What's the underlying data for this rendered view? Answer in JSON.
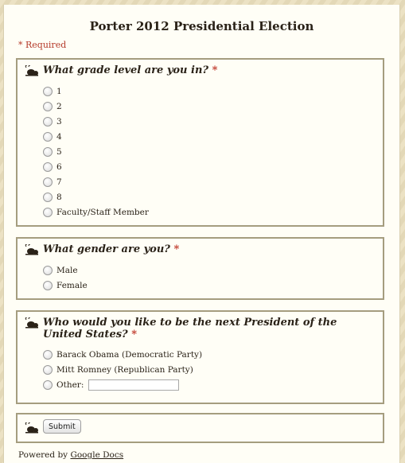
{
  "form": {
    "title": "Porter 2012 Presidential Election",
    "required_note": "* Required"
  },
  "questions": [
    {
      "label": "What grade level are you in?",
      "required_star": "*",
      "options": [
        "1",
        "2",
        "3",
        "4",
        "5",
        "6",
        "7",
        "8",
        "Faculty/Staff Member"
      ]
    },
    {
      "label": "What gender are you?",
      "required_star": "*",
      "options": [
        "Male",
        "Female"
      ]
    },
    {
      "label": "Who would you like to be the next President of the United States?",
      "required_star": "*",
      "options": [
        "Barack Obama (Democratic Party)",
        "Mitt Romney (Republican Party)",
        "Other:"
      ],
      "other_value": ""
    }
  ],
  "submit": {
    "label": "Submit"
  },
  "footer": {
    "prefix": "Powered by ",
    "link": "Google Docs"
  },
  "icons": {
    "question_bullet": "snail-bullet-icon"
  },
  "colors": {
    "accent_required": "#c0392b",
    "border": "#a59d7f",
    "background": "#eadfbd"
  }
}
